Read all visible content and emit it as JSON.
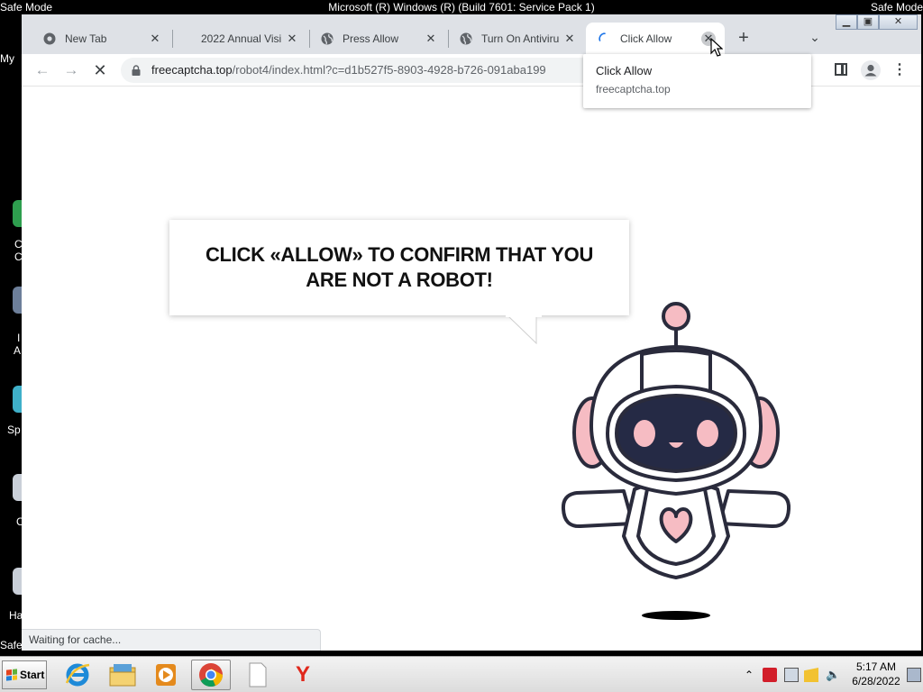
{
  "system": {
    "safe_mode_label": "Safe Mode",
    "title": "Microsoft (R) Windows (R) (Build 7601: Service Pack 1)",
    "desktop_peek_labels": [
      "My",
      "C",
      "C",
      "I",
      "A",
      "Sp",
      "C",
      "Ha"
    ]
  },
  "browser": {
    "tabs": [
      {
        "title": "New Tab",
        "icon": "chrome-icon",
        "active": false
      },
      {
        "title": "2022 Annual Visi",
        "icon": "none",
        "active": false
      },
      {
        "title": "Press Allow",
        "icon": "globe-icon",
        "active": false
      },
      {
        "title": "Turn On Antiviru",
        "icon": "globe-icon",
        "active": false
      },
      {
        "title": "Click Allow",
        "icon": "loading-spinner-icon",
        "active": true
      }
    ],
    "url_host": "freecaptcha.top",
    "url_path": "/robot4/index.html?c=d1b527f5-8903-4928-b726-091aba199",
    "hover_card": {
      "title": "Click Allow",
      "host": "freecaptcha.top"
    },
    "status_text": "Waiting for cache..."
  },
  "page": {
    "bubble_text": "CLICK «ALLOW» TO CONFIRM THAT YOU ARE NOT A ROBOT!",
    "colors": {
      "robot_outline": "#2a2b3c",
      "robot_accent": "#f6bcc3",
      "robot_visor": "#252a45"
    }
  },
  "taskbar": {
    "start_label": "Start",
    "apps": [
      "internet-explorer-icon",
      "file-explorer-icon",
      "media-player-icon",
      "chrome-icon",
      "blank-document-icon",
      "yandex-icon"
    ],
    "clock_time": "5:17 AM",
    "clock_date": "6/28/2022"
  }
}
